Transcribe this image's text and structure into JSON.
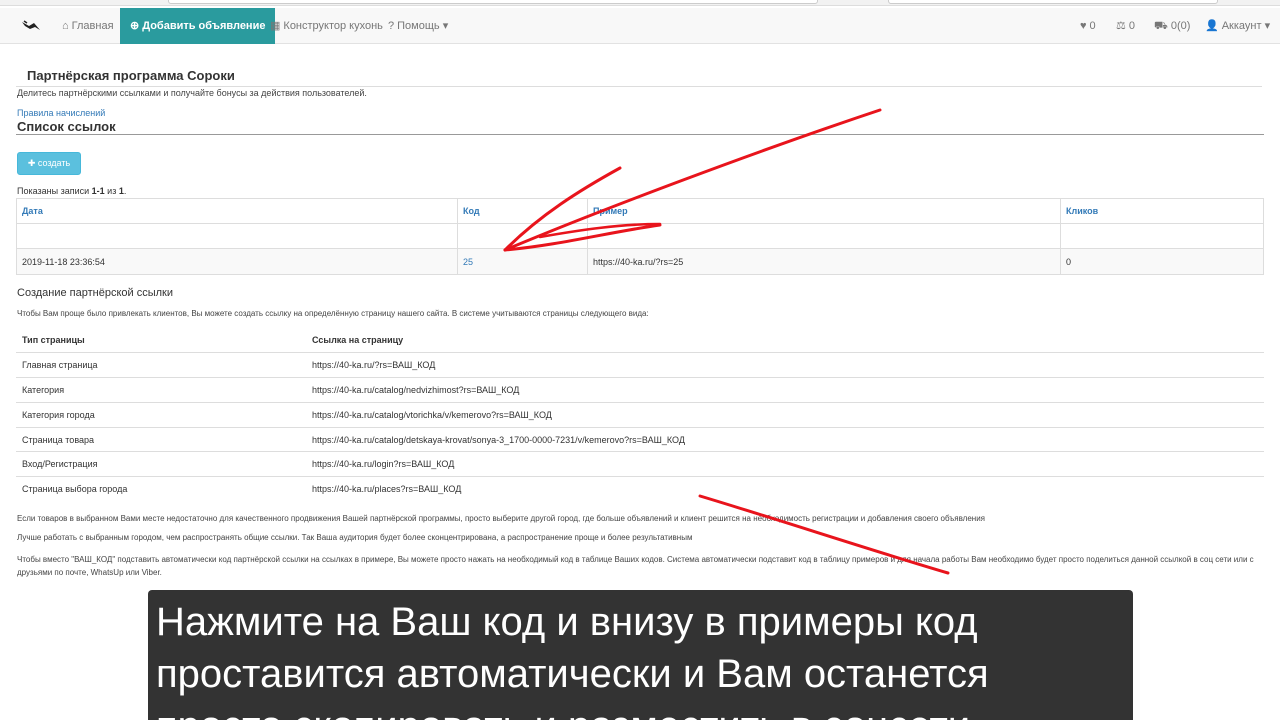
{
  "navbar": {
    "items": [
      {
        "icon": "home-icon",
        "label": "Главная"
      },
      {
        "icon": "plus-circle-icon",
        "label": "Добавить объявление"
      },
      {
        "icon": "grid-icon",
        "label": "Конструктор кухонь"
      },
      {
        "icon": "question-circle-icon",
        "label": "Помощь"
      }
    ],
    "right": {
      "favorites_count": "0",
      "compare_count": "0",
      "cart_label": "0(0)",
      "account_label": "Аккаунт"
    },
    "accent_color": "#2a9b9e"
  },
  "page": {
    "title": "Партнёрская программа Сороки",
    "description": "Делитесь партнёрскими ссылками и получайте бонусы за действия пользователей.",
    "rules_link": "Правила начислений",
    "list_title": "Список ссылок",
    "create_button": "создать",
    "shown_prefix": "Показаны записи ",
    "shown_range": "1-1",
    "shown_mid": " из ",
    "shown_total": "1",
    "shown_suffix": "."
  },
  "links_table": {
    "headers": [
      "Дата",
      "Код",
      "Пример",
      "Кликов"
    ],
    "rows": [
      {
        "date": "2019-11-18 23:36:54",
        "code": "25",
        "example": "https://40-ka.ru/?rs=25",
        "clicks": "0"
      }
    ]
  },
  "create_section": {
    "title": "Создание партнёрской ссылки",
    "description": "Чтобы Вам проще было привлекать клиентов, Вы можете создать ссылку на определённую страницу нашего сайта. В системе учитываются страницы следующего вида:",
    "headers": [
      "Тип страницы",
      "Ссылка на страницу"
    ],
    "rows": [
      {
        "type": "Главная страница",
        "link": "https://40-ka.ru/?rs=ВАШ_КОД"
      },
      {
        "type": "Категория",
        "link": "https://40-ka.ru/catalog/nedvizhimost?rs=ВАШ_КОД"
      },
      {
        "type": "Категория города",
        "link": "https://40-ka.ru/catalog/vtorichka/v/kemerovo?rs=ВАШ_КОД"
      },
      {
        "type": "Страница товара",
        "link": "https://40-ka.ru/catalog/detskaya-krovat/sonya-3_1700-0000-7231/v/kemerovo?rs=ВАШ_КОД"
      },
      {
        "type": "Вход/Регистрация",
        "link": "https://40-ka.ru/login?rs=ВАШ_КОД"
      },
      {
        "type": "Страница выбора города",
        "link": "https://40-ka.ru/places?rs=ВАШ_КОД"
      }
    ]
  },
  "notes": {
    "p1": "Если товаров в выбранном Вами месте недостаточно для качественного продвижения Вашей партнёрской программы, просто выберите другой город, где больше объявлений и клиент решится на необходимость регистрации и добавления своего объявления",
    "p2": "Лучше работать с выбранным городом, чем распространять общие ссылки. Так Ваша аудитория будет более сконцентрирована, а распространение проще и более результативным",
    "p3": "Чтобы вместо \"ВАШ_КОД\" подставить автоматически код партнёрской ссылки на ссылках в примере, Вы можете просто нажать на необходимый код в таблице Ваших кодов. Система автоматически подставит код в таблицу примеров и для начала работы Вам необходимо будет просто поделиться данной ссылкой в соц сети или с друзьями по почте, WhatsUp или Viber."
  },
  "subtitle": {
    "lines": [
      "Нажмите на Ваш код и внизу в примеры код",
      "проставится автоматически и Вам останется",
      "просто скопировать и разместить в соцсети"
    ]
  },
  "annotation_color": "#e8141c"
}
